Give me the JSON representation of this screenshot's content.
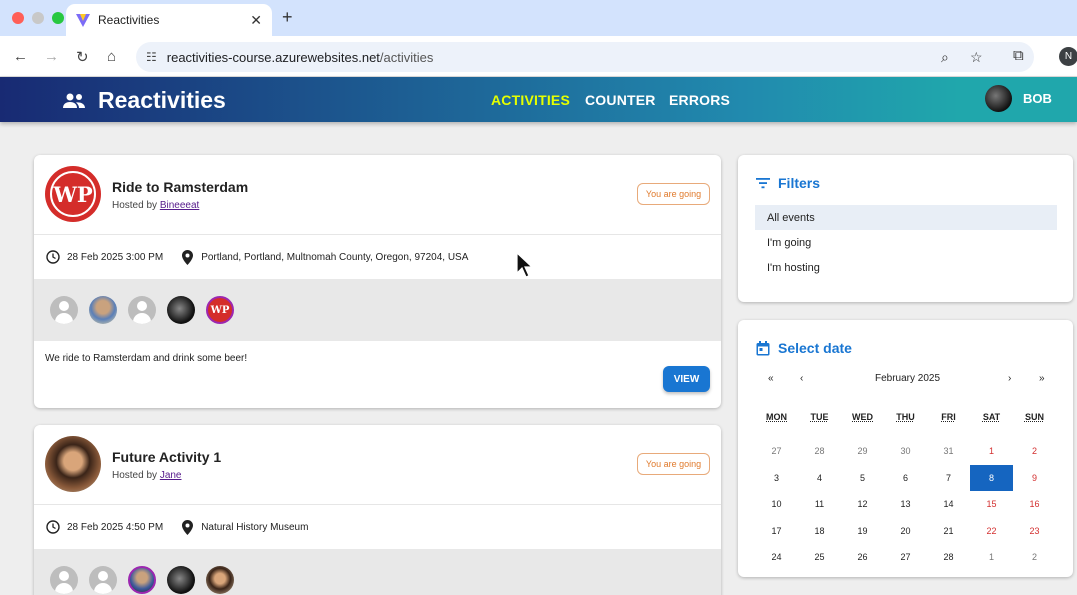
{
  "browser": {
    "tab_title": "Reactivities",
    "url_host": "reactivities-course.azurewebsites.net",
    "url_path": "/activities",
    "profile_initial": "N"
  },
  "header": {
    "brand": "Reactivities",
    "nav": [
      "ACTIVITIES",
      "COUNTER",
      "ERRORS"
    ],
    "active_nav": "ACTIVITIES",
    "user": "BOB",
    "accent_active": "#e5ff00"
  },
  "activities": [
    {
      "title": "Ride to Ramsterdam",
      "hosted_prefix": "Hosted by",
      "host": "Bineeeat",
      "badge": "You are going",
      "date": "28 Feb 2025 3:00 PM",
      "venue": "Portland, Portland, Multnomah County, Oregon, 97204, USA",
      "description": "We ride to Ramsterdam and drink some beer!",
      "view_label": "VIEW",
      "avatar_text": "WP"
    },
    {
      "title": "Future Activity 1",
      "hosted_prefix": "Hosted by",
      "host": "Jane",
      "badge": "You are going",
      "date": "28 Feb 2025 4:50 PM",
      "venue": "Natural History Museum"
    }
  ],
  "filters": {
    "title": "Filters",
    "items": [
      "All events",
      "I'm going",
      "I'm hosting"
    ],
    "selected": "All events"
  },
  "calendar": {
    "title": "Select date",
    "month": "February 2025",
    "prev_year": "«",
    "prev_month": "‹",
    "next_month": "›",
    "next_year": "»",
    "weekdays": [
      "MON",
      "TUE",
      "WED",
      "THU",
      "FRI",
      "SAT",
      "SUN"
    ],
    "weeks": [
      [
        "27",
        "28",
        "29",
        "30",
        "31",
        "1",
        "2"
      ],
      [
        "3",
        "4",
        "5",
        "6",
        "7",
        "8",
        "9"
      ],
      [
        "10",
        "11",
        "12",
        "13",
        "14",
        "15",
        "16"
      ],
      [
        "17",
        "18",
        "19",
        "20",
        "21",
        "22",
        "23"
      ],
      [
        "24",
        "25",
        "26",
        "27",
        "28",
        "1",
        "2"
      ]
    ],
    "selected_day": "8"
  }
}
